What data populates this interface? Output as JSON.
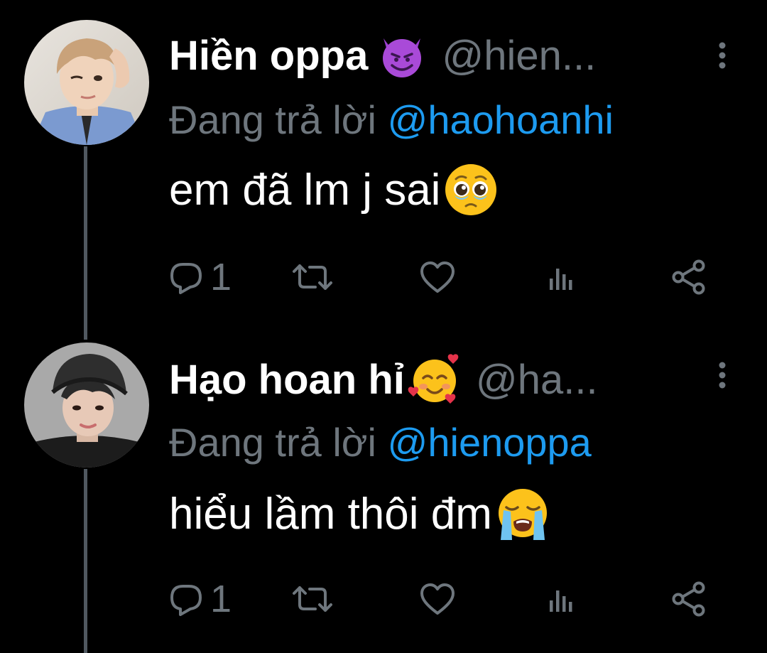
{
  "tweets": [
    {
      "display_name": "Hiền oppa",
      "name_emoji": "smiling-devil-emoji",
      "handle": "@hien...",
      "reply_prefix": "Đang trả lời",
      "reply_mention": "@haohoanhi",
      "text": "em đã lm j sai",
      "text_emoji": "pleading-face-emoji",
      "reply_count": "1",
      "avatar": "profile-photo-blond"
    },
    {
      "display_name": "Hạo hoan hỉ",
      "name_emoji": "smiling-face-with-hearts-emoji",
      "handle": "@ha...",
      "reply_prefix": "Đang trả lời",
      "reply_mention": "@hienoppa",
      "text": "hiểu lầm thôi đm",
      "text_emoji": "loudly-crying-face-emoji",
      "reply_count": "1",
      "avatar": "profile-photo-beanie"
    }
  ],
  "icons": {
    "reply": "reply-icon",
    "retweet": "retweet-icon",
    "like": "heart-icon",
    "stats": "stats-icon",
    "share": "share-icon",
    "more": "more-vertical-icon"
  },
  "colors": {
    "background": "#000000",
    "text": "#ffffff",
    "muted": "#6e767d",
    "mention": "#1d9bf0",
    "thread_line": "#505860"
  }
}
